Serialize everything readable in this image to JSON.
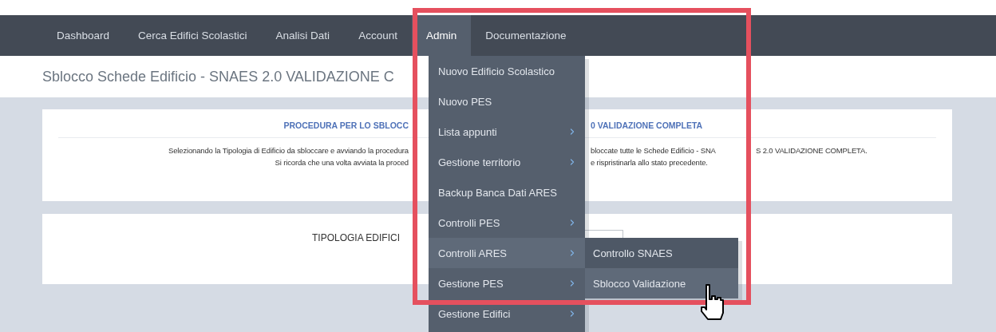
{
  "nav": [
    {
      "label": "Dashboard",
      "selected": false
    },
    {
      "label": "Cerca Edifici Scolastici",
      "selected": false
    },
    {
      "label": "Analisi Dati",
      "selected": false
    },
    {
      "label": "Account",
      "selected": false
    },
    {
      "label": "Admin",
      "selected": true
    },
    {
      "label": "Documentazione",
      "selected": false
    }
  ],
  "page_title": "Sblocco Schede Edificio - SNAES 2.0 VALIDAZIONE C",
  "info_card": {
    "heading": {
      "left": "PROCEDURA PER LO SBLOCC",
      "right": "0 VALIDAZIONE COMPLETA"
    },
    "lines": [
      {
        "left": "Selezionando la Tipologia di Edificio da sbloccare e avviando la procedura",
        "right": "bloccate tutte le Schede Edificio - SNA",
        "far_right": "S 2.0 VALIDAZIONE COMPLETA."
      },
      {
        "left": "Si ricorda che una volta avviata la proced",
        "right": "e rispristinarla allo stato precedente."
      }
    ]
  },
  "form_card": {
    "label": "TIPOLOGIA EDIFICI"
  },
  "admin_menu": {
    "items": [
      {
        "label": "Nuovo Edificio Scolastico",
        "has_submenu": false,
        "selected": false
      },
      {
        "label": "Nuovo PES",
        "has_submenu": false,
        "selected": false
      },
      {
        "label": "Lista appunti",
        "has_submenu": true,
        "selected": false
      },
      {
        "label": "Gestione territorio",
        "has_submenu": true,
        "selected": false
      },
      {
        "label": "Backup Banca Dati ARES",
        "has_submenu": false,
        "selected": false
      },
      {
        "label": "Controlli PES",
        "has_submenu": true,
        "selected": false
      },
      {
        "label": "Controlli ARES",
        "has_submenu": true,
        "selected": true
      },
      {
        "label": "Gestione PES",
        "has_submenu": true,
        "selected": false
      },
      {
        "label": "Gestione Edifici",
        "has_submenu": true,
        "selected": false
      }
    ]
  },
  "submenu": {
    "items": [
      {
        "label": "Controllo SNAES",
        "selected": false
      },
      {
        "label": "Sblocco Validazione",
        "selected": true
      }
    ]
  }
}
